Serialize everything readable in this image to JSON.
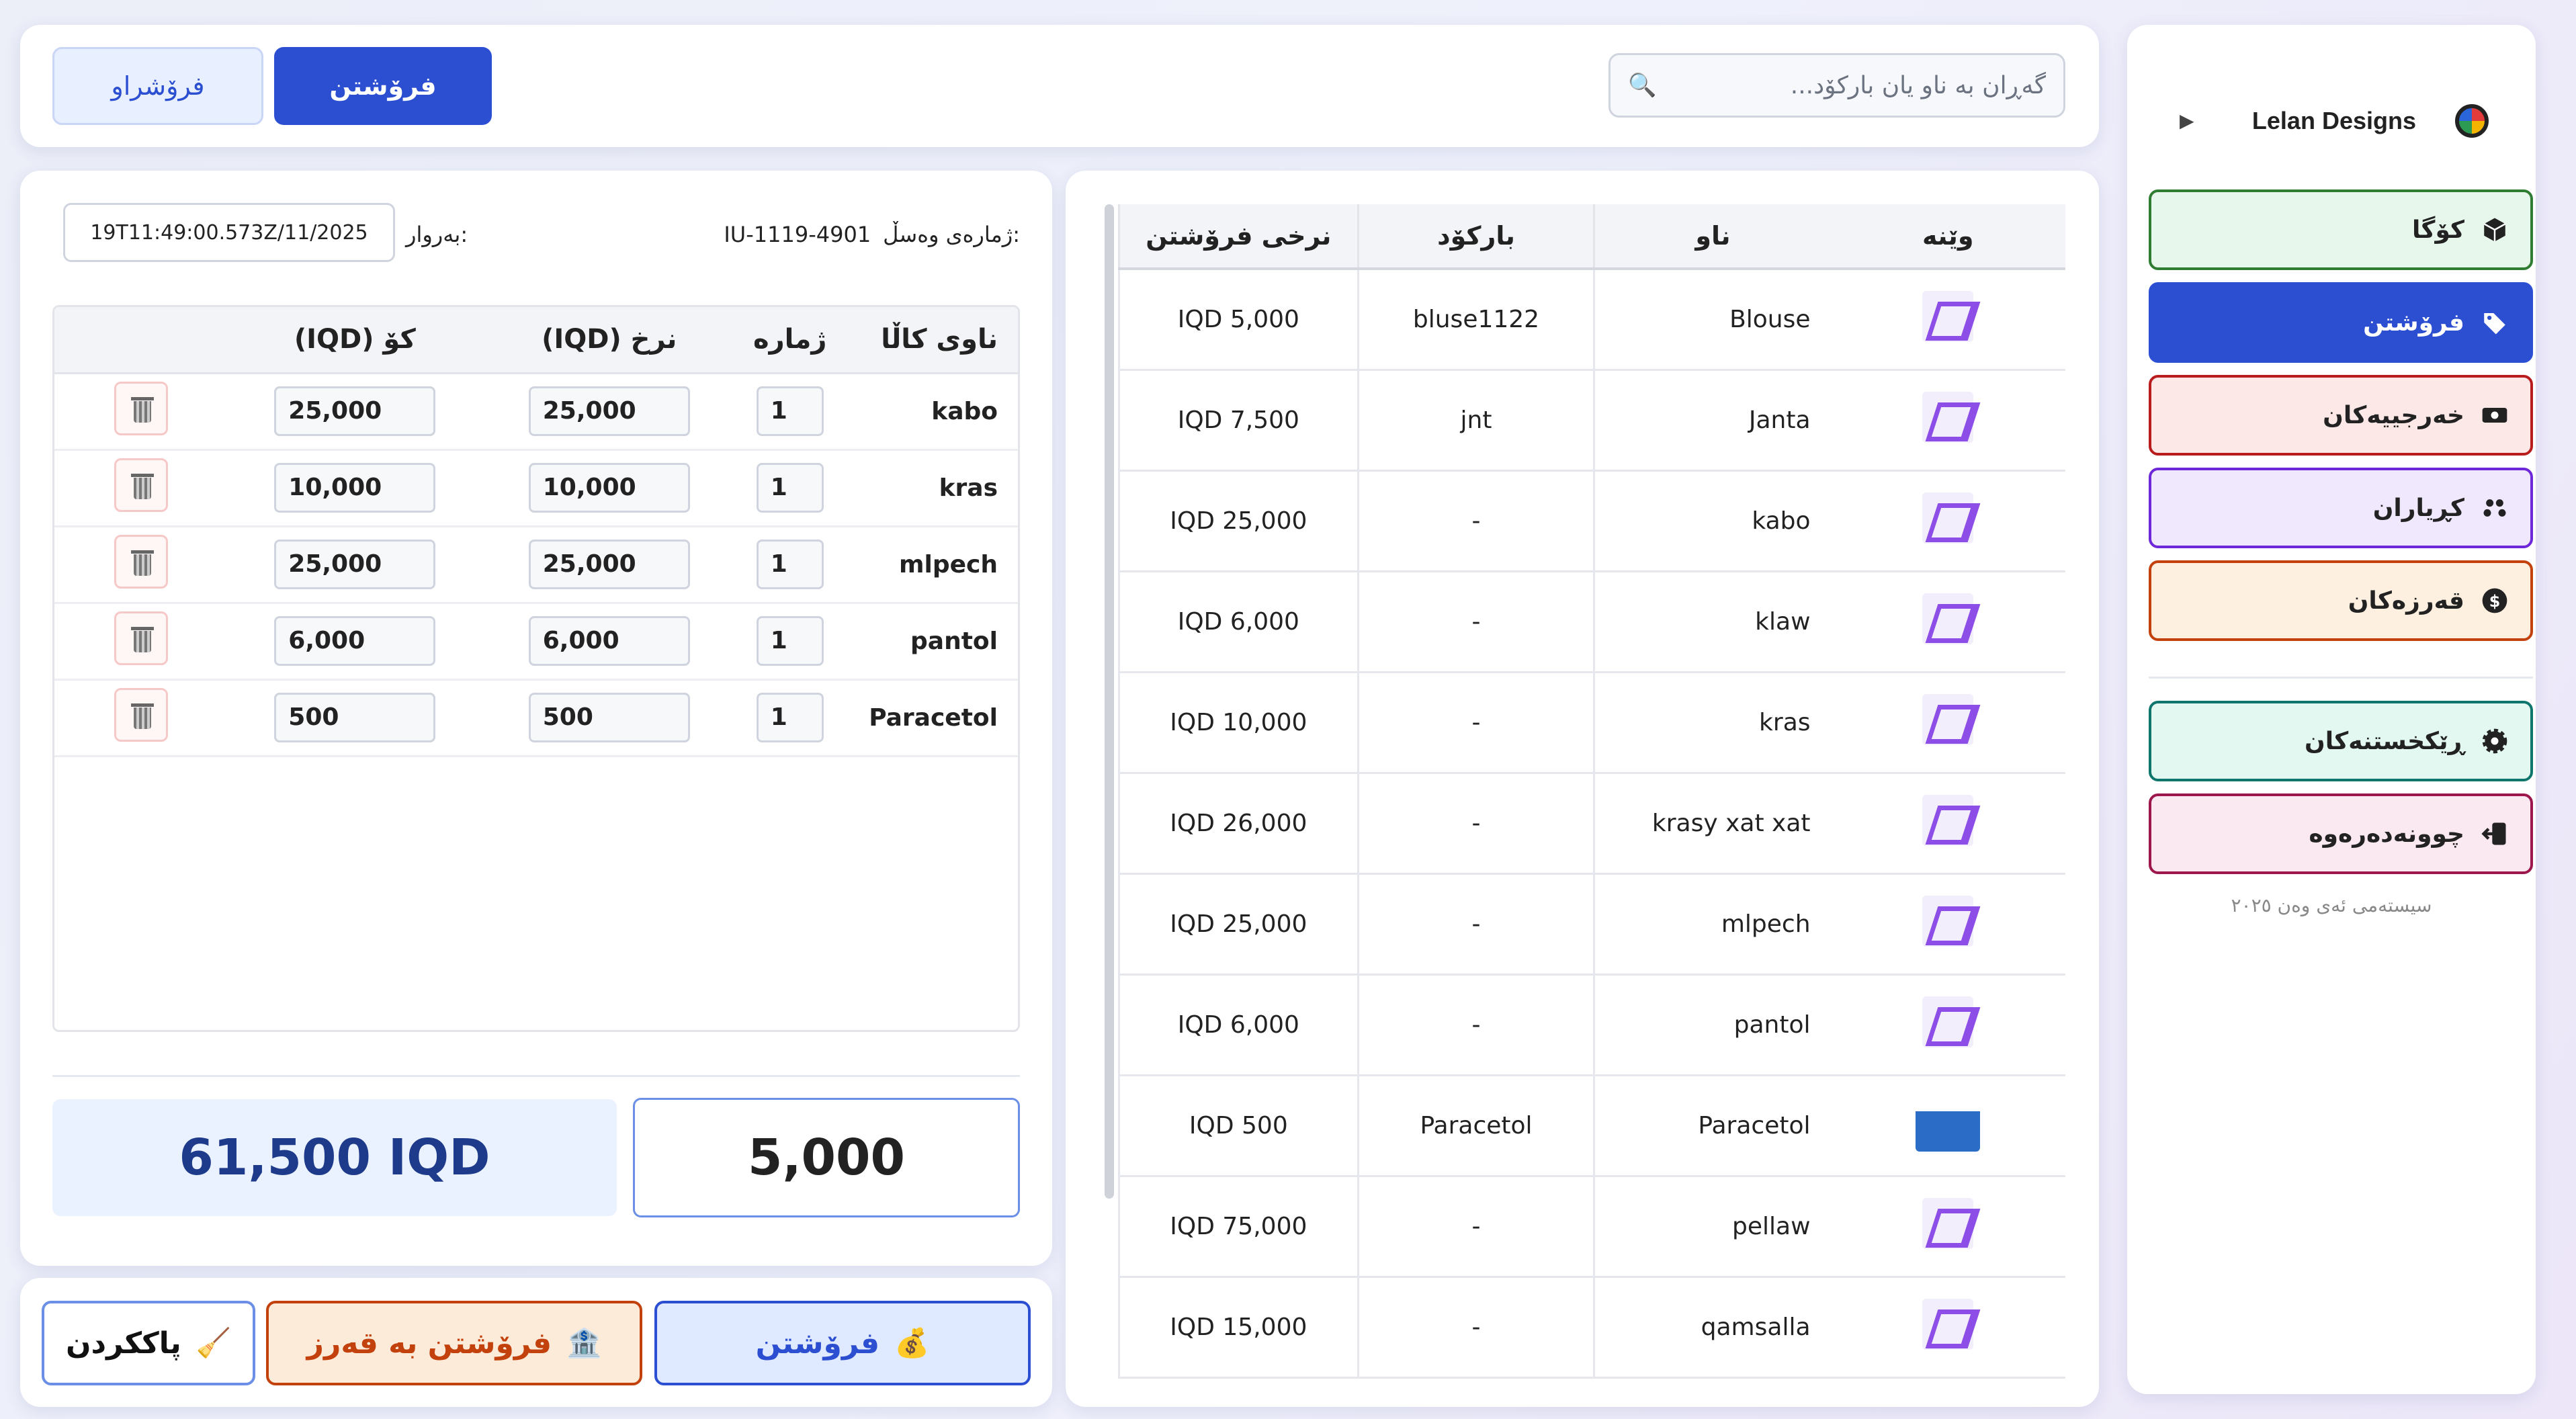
{
  "sidebar": {
    "brand_name": "Lelan Designs",
    "toggle_glyph": "▶",
    "nav": [
      {
        "label": "کۆگا",
        "icon": "cube-icon",
        "color": "#2e7d32",
        "bg": "#e8f7ec"
      },
      {
        "label": "فرۆشتن",
        "icon": "tag-icon",
        "color": "#2c4fd2",
        "bg": "#2c4fd2"
      },
      {
        "label": "خەرجییەکان",
        "icon": "money-icon",
        "color": "#b91c1c",
        "bg": "#fde8e8"
      },
      {
        "label": "کڕیاران",
        "icon": "users-icon",
        "color": "#6d28d9",
        "bg": "#f0e9fe"
      },
      {
        "label": "قەرزەکان",
        "icon": "dollar-icon",
        "color": "#c2410c",
        "bg": "#fdf0e0"
      }
    ],
    "nav2": [
      {
        "label": "ڕێکخستنەکان",
        "icon": "gear-icon",
        "color": "#0f766e",
        "bg": "#e3f8f1"
      },
      {
        "label": "چوونەدەرەوە",
        "icon": "logout-icon",
        "color": "#9d174d",
        "bg": "#fbe9f1"
      }
    ],
    "footer": "سیستەمی ئەی وەن ٢٠٢٥"
  },
  "topbar": {
    "search_placeholder": "گەڕان بە ناو یان بارکۆد...",
    "tab_sell": "فرۆشتن",
    "tab_sold": "فرۆشراو"
  },
  "products": {
    "headers": [
      "وێنە",
      "ناو",
      "بارکۆد",
      "نرخی فرۆشتن"
    ],
    "rows": [
      {
        "name": "Blouse",
        "barcode": "bluse1122",
        "price": "5,000 IQD",
        "img": "logo"
      },
      {
        "name": "Janta",
        "barcode": "jnt",
        "price": "7,500 IQD",
        "img": "logo"
      },
      {
        "name": "kabo",
        "barcode": "-",
        "price": "25,000 IQD",
        "img": "logo"
      },
      {
        "name": "klaw",
        "barcode": "-",
        "price": "6,000 IQD",
        "img": "logo"
      },
      {
        "name": "kras",
        "barcode": "-",
        "price": "10,000 IQD",
        "img": "logo"
      },
      {
        "name": "krasy xat xat",
        "barcode": "-",
        "price": "26,000 IQD",
        "img": "logo"
      },
      {
        "name": "mlpech",
        "barcode": "-",
        "price": "25,000 IQD",
        "img": "logo"
      },
      {
        "name": "pantol",
        "barcode": "-",
        "price": "6,000 IQD",
        "img": "logo"
      },
      {
        "name": "Paracetol",
        "barcode": "Paracetol",
        "price": "500 IQD",
        "img": "photo"
      },
      {
        "name": "pellaw",
        "barcode": "-",
        "price": "75,000 IQD",
        "img": "logo"
      },
      {
        "name": "qamsalla",
        "barcode": "-",
        "price": "15,000 IQD",
        "img": "logo"
      }
    ]
  },
  "invoice": {
    "number_label": "ژمارەی وەسڵ:",
    "number": "IU-1119-4901",
    "date_label": "بەروار:",
    "date": "19T11:49:00.573Z/11/2025",
    "headers": [
      "ناوی کاڵا",
      "ژمارە",
      "نرخ (IQD)",
      "کۆ (IQD)"
    ],
    "items": [
      {
        "name": "kabo",
        "qty": "1",
        "price": "25,000",
        "total": "25,000"
      },
      {
        "name": "kras",
        "qty": "1",
        "price": "10,000",
        "total": "10,000"
      },
      {
        "name": "mlpech",
        "qty": "1",
        "price": "25,000",
        "total": "25,000"
      },
      {
        "name": "pantol",
        "qty": "1",
        "price": "6,000",
        "total": "6,000"
      },
      {
        "name": "Paracetol",
        "qty": "1",
        "price": "500",
        "total": "500"
      }
    ],
    "grand_total": "61,500 IQD",
    "paid": "5,000"
  },
  "actions": {
    "sell": "فرۆشتن",
    "sell_emoji": "💰",
    "credit": "فرۆشتن بە قەرز",
    "credit_emoji": "🏦",
    "clear": "پاککردن",
    "clear_emoji": "🧹"
  }
}
